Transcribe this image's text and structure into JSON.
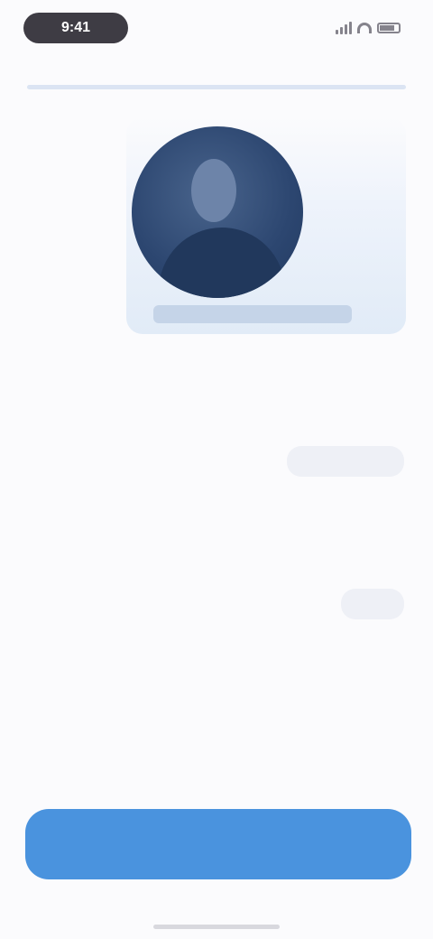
{
  "status_bar": {
    "time": "9:41",
    "icons": [
      "signal-icon",
      "wifi-icon",
      "battery-icon"
    ]
  },
  "photo": {
    "caption": ""
  },
  "messages": [
    {
      "text": ""
    },
    {
      "text": ""
    },
    {
      "text": ""
    }
  ],
  "replies": [
    {
      "label": ""
    },
    {
      "label": ""
    }
  ],
  "primary_button": {
    "label": ""
  },
  "colors": {
    "accent": "#4a93de",
    "avatar_dark": "#2c4670",
    "bubble": "#eef0f6",
    "divider": "#dbe4f3"
  }
}
